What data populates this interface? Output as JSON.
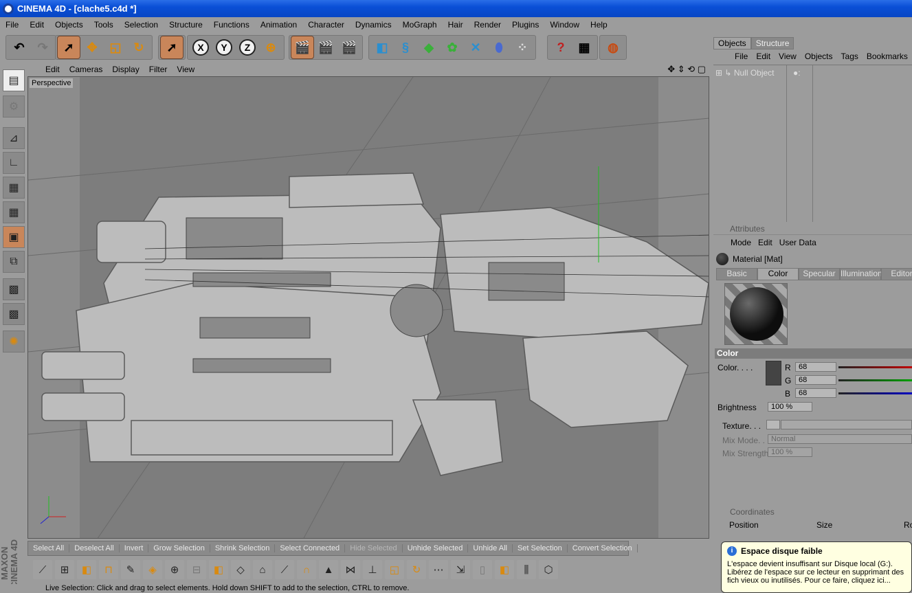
{
  "window": {
    "title": "CINEMA 4D - [clache5.c4d *]"
  },
  "menu": [
    "File",
    "Edit",
    "Objects",
    "Tools",
    "Selection",
    "Structure",
    "Functions",
    "Animation",
    "Character",
    "Dynamics",
    "MoGraph",
    "Hair",
    "Render",
    "Plugins",
    "Window",
    "Help"
  ],
  "toolbar": {
    "undo": "undo-icon",
    "redo": "redo-icon",
    "axis_x": "X",
    "axis_y": "Y",
    "axis_z": "Z"
  },
  "viewport": {
    "menu": [
      "Edit",
      "Cameras",
      "Display",
      "Filter",
      "View"
    ],
    "label": "Perspective"
  },
  "selection_bar": [
    "Select All",
    "Deselect All",
    "Invert",
    "Grow Selection",
    "Shrink Selection",
    "Select Connected",
    "Hide Selected",
    "Unhide Selected",
    "Unhide All",
    "Set Selection",
    "Convert Selection"
  ],
  "status": "Live Selection: Click and drag to select elements. Hold down SHIFT to add to the selection, CTRL to remove.",
  "brand": "MAXON CINEMA 4D",
  "objects": {
    "tabs": [
      "Objects",
      "Structure"
    ],
    "menu": [
      "File",
      "Edit",
      "View",
      "Objects",
      "Tags",
      "Bookmarks"
    ],
    "items": [
      {
        "name": "Null Object"
      }
    ]
  },
  "attributes": {
    "header": "Attributes",
    "menu": [
      "Mode",
      "Edit",
      "User Data"
    ],
    "material": "Material [Mat]",
    "tabs": [
      "Basic",
      "Color",
      "Specular",
      "Illumination",
      "Editor"
    ],
    "color_section": "Color",
    "color_label": "Color. . . .",
    "r_label": "R",
    "g_label": "G",
    "b_label": "B",
    "r": "68",
    "g": "68",
    "b": "68",
    "brightness_label": "Brightness",
    "brightness": "100 %",
    "texture_label": "Texture. . .",
    "mix_mode_label": "Mix Mode. .",
    "mix_mode": "Normal",
    "mix_strength_label": "Mix Strength",
    "mix_strength": "100 %"
  },
  "coordinates": {
    "header": "Coordinates",
    "position": "Position",
    "size": "Size",
    "rot": "Ro"
  },
  "notification": {
    "title": "Espace disque faible",
    "body": "L'espace devient insuffisant sur Disque local (G:). Libérez de l'espace sur ce lecteur en supprimant des fich vieux ou inutilisés. Pour ce faire, cliquez ici..."
  }
}
